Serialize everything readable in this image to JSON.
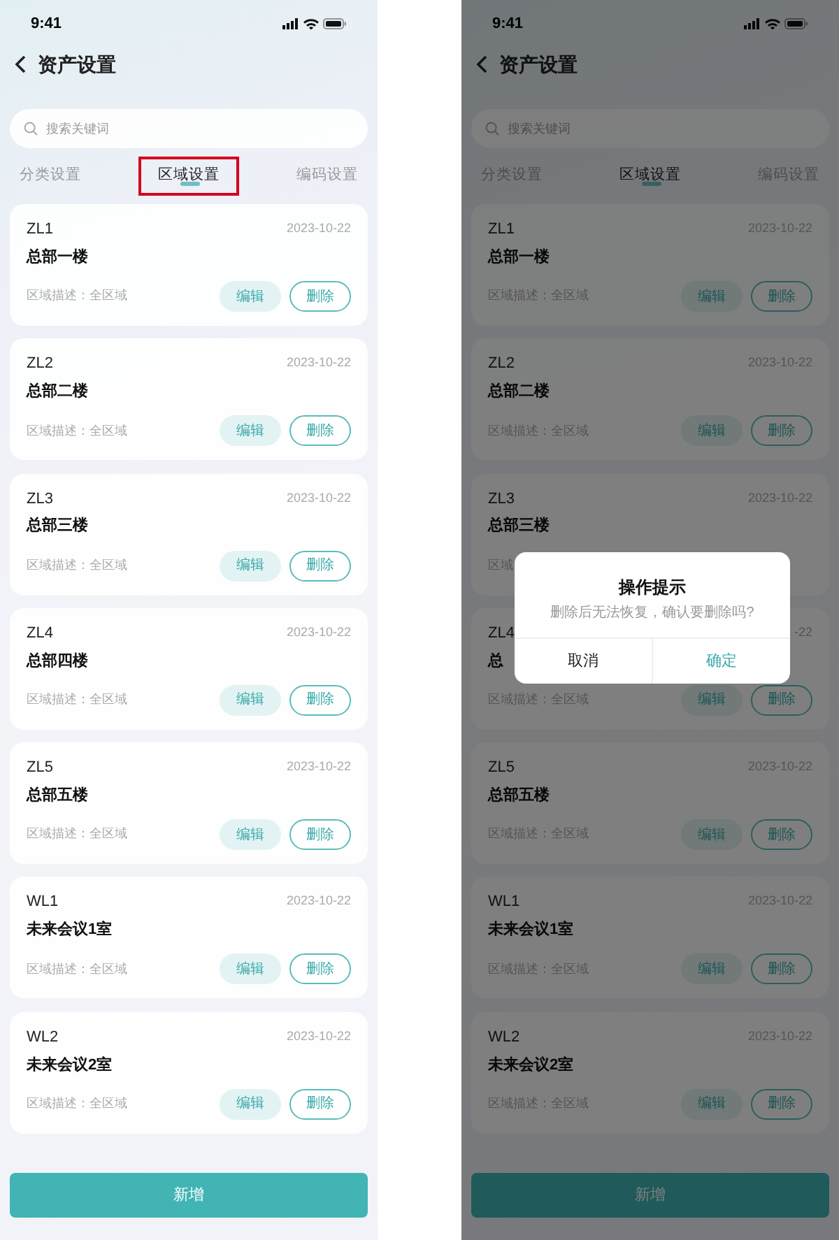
{
  "screens": [
    {
      "status_bar": {
        "time": "9:41"
      },
      "header": {
        "title": "资产设置"
      },
      "search": {
        "placeholder": "搜索关键词"
      },
      "tabs": [
        {
          "label": "分类设置",
          "selected": false,
          "highlighted": false
        },
        {
          "label": "区域设置",
          "selected": true,
          "highlighted": true
        },
        {
          "label": "编码设置",
          "selected": false,
          "highlighted": false
        }
      ],
      "cards": [
        {
          "code": "ZL1",
          "date": "2023-10-22",
          "name": "总部一楼",
          "description": "区域描述：全区域",
          "edit": "编辑",
          "delete": "删除"
        },
        {
          "code": "ZL2",
          "date": "2023-10-22",
          "name": "总部二楼",
          "description": "区域描述：全区域",
          "edit": "编辑",
          "delete": "删除"
        },
        {
          "code": "ZL3",
          "date": "2023-10-22",
          "name": "总部三楼",
          "description": "区域描述：全区域",
          "edit": "编辑",
          "delete": "删除"
        },
        {
          "code": "ZL4",
          "date": "2023-10-22",
          "name": "总部四楼",
          "description": "区域描述：全区域",
          "edit": "编辑",
          "delete": "删除"
        },
        {
          "code": "ZL5",
          "date": "2023-10-22",
          "name": "总部五楼",
          "description": "区域描述：全区域",
          "edit": "编辑",
          "delete": "删除"
        },
        {
          "code": "WL1",
          "date": "2023-10-22",
          "name": "未来会议1室",
          "description": "区域描述：全区域",
          "edit": "编辑",
          "delete": "删除"
        },
        {
          "code": "WL2",
          "date": "2023-10-22",
          "name": "未来会议2室",
          "description": "区域描述：全区域",
          "edit": "编辑",
          "delete": "删除"
        }
      ],
      "add_button": "新增"
    },
    {
      "status_bar": {
        "time": "9:41"
      },
      "header": {
        "title": "资产设置"
      },
      "search": {
        "placeholder": "搜索关键词"
      },
      "tabs": [
        {
          "label": "分类设置",
          "selected": false,
          "highlighted": false
        },
        {
          "label": "区域设置",
          "selected": true,
          "highlighted": false
        },
        {
          "label": "编码设置",
          "selected": false,
          "highlighted": false
        }
      ],
      "cards": [
        {
          "code": "ZL1",
          "date": "2023-10-22",
          "name": "总部一楼",
          "description": "区域描述：全区域",
          "edit": "编辑",
          "delete": "删除"
        },
        {
          "code": "ZL2",
          "date": "2023-10-22",
          "name": "总部二楼",
          "description": "区域描述：全区域",
          "edit": "编辑",
          "delete": "删除"
        },
        {
          "code": "ZL3",
          "date": "2023-10-22",
          "name": "总部三楼",
          "description": "区域"
        },
        {
          "code": "ZL4",
          "date": "-22",
          "name": "总",
          "description": "区域描述：全区域",
          "edit": "编辑",
          "delete": "删除"
        },
        {
          "code": "ZL5",
          "date": "2023-10-22",
          "name": "总部五楼",
          "description": "区域描述：全区域",
          "edit": "编辑",
          "delete": "删除"
        },
        {
          "code": "WL1",
          "date": "2023-10-22",
          "name": "未来会议1室",
          "description": "区域描述：全区域",
          "edit": "编辑",
          "delete": "删除"
        },
        {
          "code": "WL2",
          "date": "2023-10-22",
          "name": "未来会议2室",
          "description": "区域描述：全区域",
          "edit": "编辑",
          "delete": "删除"
        }
      ],
      "add_button": "新增",
      "dialog": {
        "title": "操作提示",
        "message": "删除后无法恢复，确认要删除吗?",
        "buttons": [
          {
            "label": "取消",
            "kind": "cancel"
          },
          {
            "label": "确定",
            "kind": "confirm"
          }
        ]
      }
    }
  ]
}
